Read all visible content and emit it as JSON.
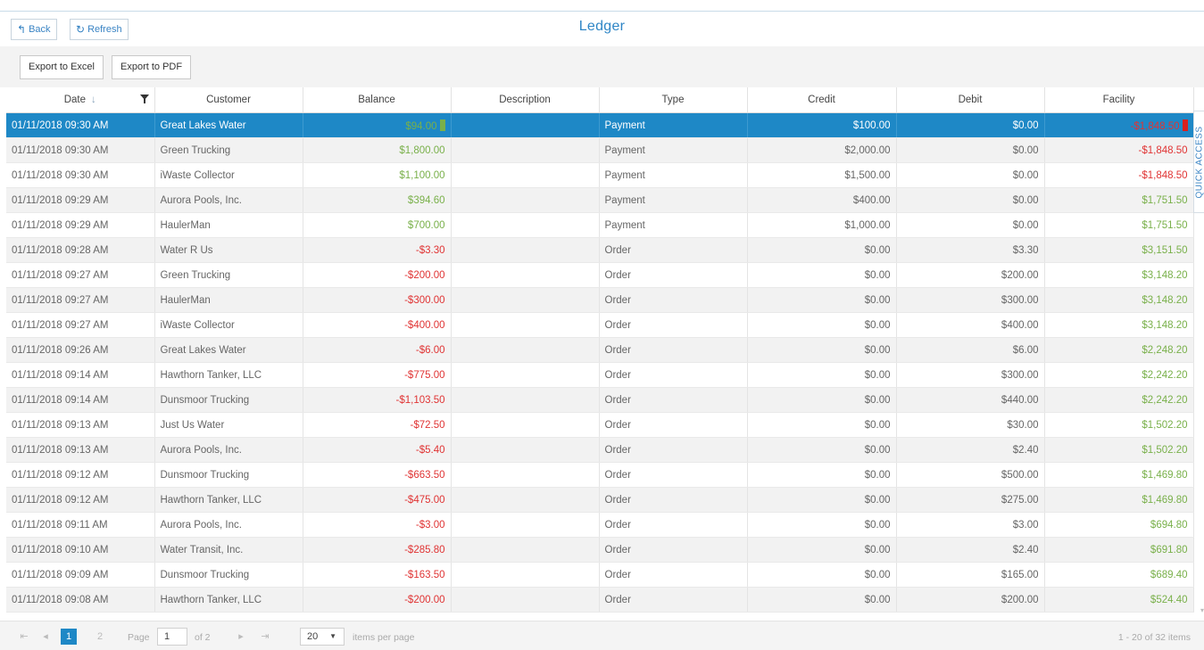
{
  "header": {
    "title": "Ledger",
    "back_label": "Back",
    "refresh_label": "Refresh"
  },
  "toolbar": {
    "export_excel": "Export to Excel",
    "export_pdf": "Export to PDF"
  },
  "quick_access": "QUICK ACCESS",
  "colors": {
    "selected_row": "#1e88c6",
    "negative": "#e03434",
    "positive": "#79b04a",
    "title": "#2f86c6"
  },
  "grid": {
    "columns": [
      "Date",
      "Customer",
      "Balance",
      "Description",
      "Type",
      "Credit",
      "Debit",
      "Facility"
    ],
    "rows": [
      {
        "date": "01/11/2018 09:30 AM",
        "customer": "Great Lakes Water",
        "balance": "$94.00",
        "description": "",
        "type": "Payment",
        "credit": "$100.00",
        "debit": "$0.00",
        "facility": "-$1,848.50",
        "selected": true
      },
      {
        "date": "01/11/2018 09:30 AM",
        "customer": "Green Trucking",
        "balance": "$1,800.00",
        "description": "",
        "type": "Payment",
        "credit": "$2,000.00",
        "debit": "$0.00",
        "facility": "-$1,848.50"
      },
      {
        "date": "01/11/2018 09:30 AM",
        "customer": "iWaste Collector",
        "balance": "$1,100.00",
        "description": "",
        "type": "Payment",
        "credit": "$1,500.00",
        "debit": "$0.00",
        "facility": "-$1,848.50"
      },
      {
        "date": "01/11/2018 09:29 AM",
        "customer": "Aurora Pools, Inc.",
        "balance": "$394.60",
        "description": "",
        "type": "Payment",
        "credit": "$400.00",
        "debit": "$0.00",
        "facility": "$1,751.50"
      },
      {
        "date": "01/11/2018 09:29 AM",
        "customer": "HaulerMan",
        "balance": "$700.00",
        "description": "",
        "type": "Payment",
        "credit": "$1,000.00",
        "debit": "$0.00",
        "facility": "$1,751.50"
      },
      {
        "date": "01/11/2018 09:28 AM",
        "customer": "Water R Us",
        "balance": "-$3.30",
        "description": "",
        "type": "Order",
        "credit": "$0.00",
        "debit": "$3.30",
        "facility": "$3,151.50"
      },
      {
        "date": "01/11/2018 09:27 AM",
        "customer": "Green Trucking",
        "balance": "-$200.00",
        "description": "",
        "type": "Order",
        "credit": "$0.00",
        "debit": "$200.00",
        "facility": "$3,148.20"
      },
      {
        "date": "01/11/2018 09:27 AM",
        "customer": "HaulerMan",
        "balance": "-$300.00",
        "description": "",
        "type": "Order",
        "credit": "$0.00",
        "debit": "$300.00",
        "facility": "$3,148.20"
      },
      {
        "date": "01/11/2018 09:27 AM",
        "customer": "iWaste Collector",
        "balance": "-$400.00",
        "description": "",
        "type": "Order",
        "credit": "$0.00",
        "debit": "$400.00",
        "facility": "$3,148.20"
      },
      {
        "date": "01/11/2018 09:26 AM",
        "customer": "Great Lakes Water",
        "balance": "-$6.00",
        "description": "",
        "type": "Order",
        "credit": "$0.00",
        "debit": "$6.00",
        "facility": "$2,248.20"
      },
      {
        "date": "01/11/2018 09:14 AM",
        "customer": "Hawthorn Tanker, LLC",
        "balance": "-$775.00",
        "description": "",
        "type": "Order",
        "credit": "$0.00",
        "debit": "$300.00",
        "facility": "$2,242.20"
      },
      {
        "date": "01/11/2018 09:14 AM",
        "customer": "Dunsmoor Trucking",
        "balance": "-$1,103.50",
        "description": "",
        "type": "Order",
        "credit": "$0.00",
        "debit": "$440.00",
        "facility": "$2,242.20"
      },
      {
        "date": "01/11/2018 09:13 AM",
        "customer": "Just Us Water",
        "balance": "-$72.50",
        "description": "",
        "type": "Order",
        "credit": "$0.00",
        "debit": "$30.00",
        "facility": "$1,502.20"
      },
      {
        "date": "01/11/2018 09:13 AM",
        "customer": "Aurora Pools, Inc.",
        "balance": "-$5.40",
        "description": "",
        "type": "Order",
        "credit": "$0.00",
        "debit": "$2.40",
        "facility": "$1,502.20"
      },
      {
        "date": "01/11/2018 09:12 AM",
        "customer": "Dunsmoor Trucking",
        "balance": "-$663.50",
        "description": "",
        "type": "Order",
        "credit": "$0.00",
        "debit": "$500.00",
        "facility": "$1,469.80"
      },
      {
        "date": "01/11/2018 09:12 AM",
        "customer": "Hawthorn Tanker, LLC",
        "balance": "-$475.00",
        "description": "",
        "type": "Order",
        "credit": "$0.00",
        "debit": "$275.00",
        "facility": "$1,469.80"
      },
      {
        "date": "01/11/2018 09:11 AM",
        "customer": "Aurora Pools, Inc.",
        "balance": "-$3.00",
        "description": "",
        "type": "Order",
        "credit": "$0.00",
        "debit": "$3.00",
        "facility": "$694.80"
      },
      {
        "date": "01/11/2018 09:10 AM",
        "customer": "Water Transit, Inc.",
        "balance": "-$285.80",
        "description": "",
        "type": "Order",
        "credit": "$0.00",
        "debit": "$2.40",
        "facility": "$691.80"
      },
      {
        "date": "01/11/2018 09:09 AM",
        "customer": "Dunsmoor Trucking",
        "balance": "-$163.50",
        "description": "",
        "type": "Order",
        "credit": "$0.00",
        "debit": "$165.00",
        "facility": "$689.40"
      },
      {
        "date": "01/11/2018 09:08 AM",
        "customer": "Hawthorn Tanker, LLC",
        "balance": "-$200.00",
        "description": "",
        "type": "Order",
        "credit": "$0.00",
        "debit": "$200.00",
        "facility": "$524.40"
      }
    ]
  },
  "pager": {
    "pages": [
      "1",
      "2"
    ],
    "current_page": "1",
    "page_label": "Page",
    "page_input": "1",
    "of_label": "of 2",
    "page_size": "20",
    "items_per_page_label": "items per page",
    "summary": "1 - 20 of 32 items"
  }
}
